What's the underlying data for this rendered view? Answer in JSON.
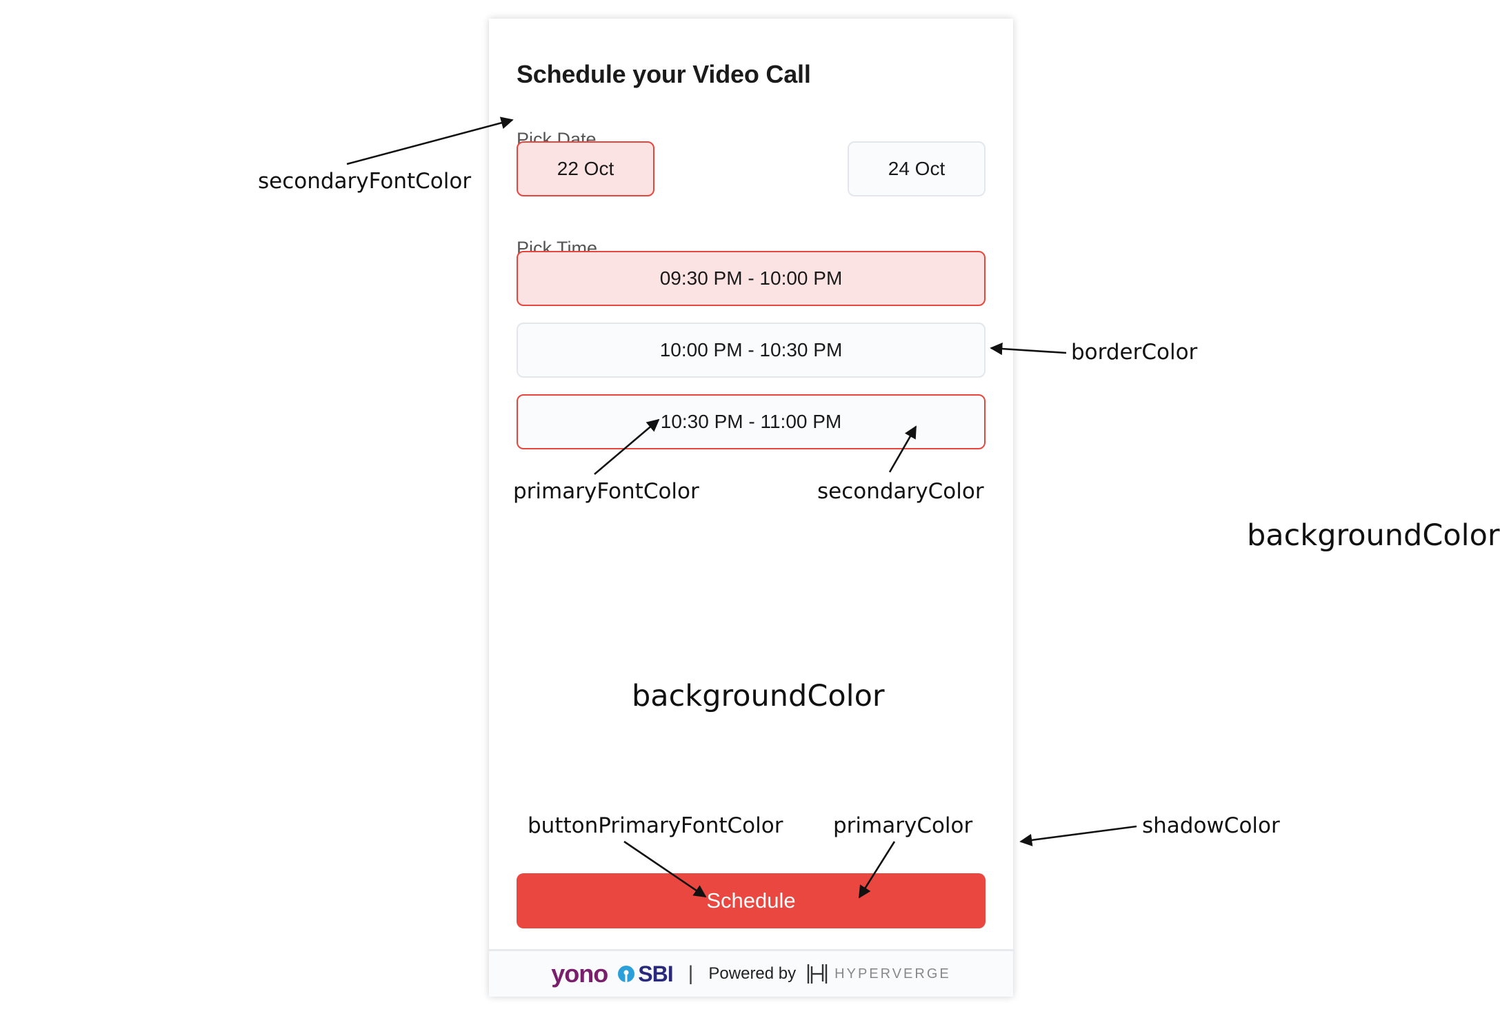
{
  "card": {
    "title": "Schedule your Video Call",
    "pick_date_label": "Pick Date",
    "dates": [
      {
        "label": "22 Oct",
        "state": "selected"
      },
      {
        "label": "24 Oct",
        "state": "unselected"
      }
    ],
    "pick_time_label": "Pick Time",
    "slots": [
      {
        "label": "09:30 PM - 10:00 PM",
        "state": "selected"
      },
      {
        "label": "10:00 PM - 10:30 PM",
        "state": "unselected"
      },
      {
        "label": "10:30 PM - 11:00 PM",
        "state": "outlined"
      }
    ],
    "button_label": "Schedule",
    "footer": {
      "brand_yono": "yono",
      "brand_sbi": "SBI",
      "separator": "|",
      "powered_by": "Powered by",
      "brand_hyperverge": "HYPERVERGE"
    }
  },
  "annotations": {
    "secondary_font_color": "secondaryFontColor",
    "border_color": "borderColor",
    "primary_font_color": "primaryFontColor",
    "secondary_color": "secondaryColor",
    "background_color_outside": "backgroundColor",
    "background_color_inside": "backgroundColor",
    "button_primary_font_color": "buttonPrimaryFontColor",
    "primary_color": "primaryColor",
    "shadow_color": "shadowColor"
  },
  "colors": {
    "primary": "#ea4740",
    "selected_fill": "#fbe3e3",
    "secondary": "#f9fbfd",
    "border": "#e3e7ec",
    "secondary_font": "#555555",
    "primary_font": "#1a1a1a",
    "button_font": "#ffffff",
    "yono": "#7a1f6b",
    "sbi": "#2a2a7c"
  },
  "icons": {
    "sbi_logo": "sbi-keyhole-icon",
    "hyperverge_logo": "hyperverge-h-icon"
  }
}
